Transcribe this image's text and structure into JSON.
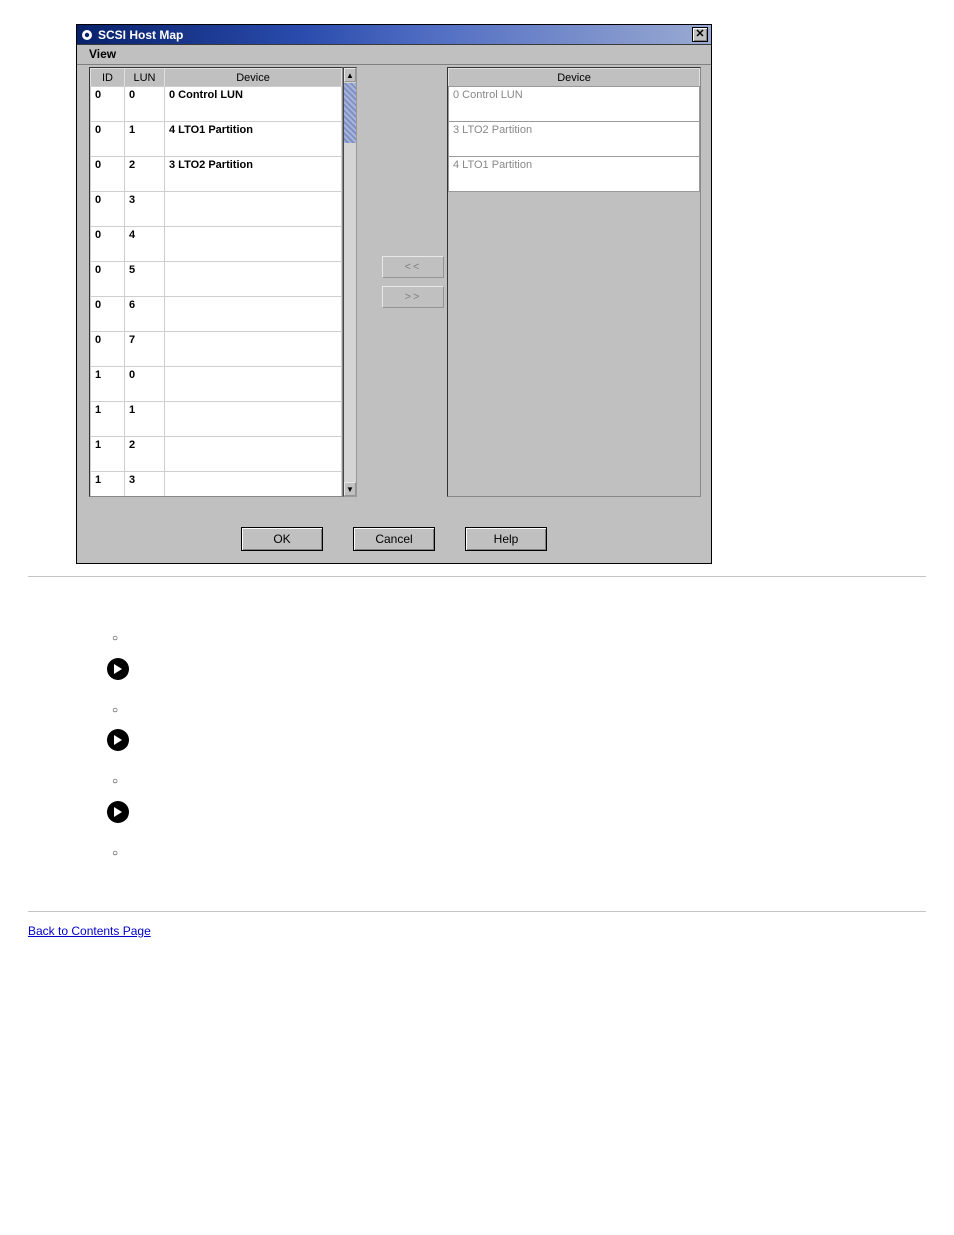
{
  "window": {
    "title": "SCSI Host Map",
    "menu": {
      "view_label": "View"
    },
    "close_glyph": "✕"
  },
  "left_table": {
    "headers": {
      "id": "ID",
      "lun": "LUN",
      "device": "Device"
    },
    "rows": [
      {
        "id": "0",
        "lun": "0",
        "device": "0  Control LUN"
      },
      {
        "id": "0",
        "lun": "1",
        "device": "4  LTO1 Partition"
      },
      {
        "id": "0",
        "lun": "2",
        "device": "3  LTO2 Partition"
      },
      {
        "id": "0",
        "lun": "3",
        "device": ""
      },
      {
        "id": "0",
        "lun": "4",
        "device": ""
      },
      {
        "id": "0",
        "lun": "5",
        "device": ""
      },
      {
        "id": "0",
        "lun": "6",
        "device": ""
      },
      {
        "id": "0",
        "lun": "7",
        "device": ""
      },
      {
        "id": "1",
        "lun": "0",
        "device": ""
      },
      {
        "id": "1",
        "lun": "1",
        "device": ""
      },
      {
        "id": "1",
        "lun": "2",
        "device": ""
      },
      {
        "id": "1",
        "lun": "3",
        "device": ""
      }
    ],
    "up_glyph": "▲",
    "down_glyph": "▼"
  },
  "transfer": {
    "left_label": "<<",
    "right_label": ">>"
  },
  "right_table": {
    "headers": {
      "device": "Device"
    },
    "rows": [
      {
        "device": "0  Control LUN"
      },
      {
        "device": "3  LTO2 Partition"
      },
      {
        "device": "4  LTO1 Partition"
      }
    ]
  },
  "buttons": {
    "ok": "OK",
    "cancel": "Cancel",
    "help": "Help"
  },
  "below": {
    "bullet_blank_1": "",
    "bullet_blank_2": "",
    "bullet_blank_3": "",
    "bullet_blank_4": "",
    "note_blank_1": "",
    "note_blank_2": "",
    "note_blank_3": ""
  },
  "footer_link": "Back to Contents Page"
}
